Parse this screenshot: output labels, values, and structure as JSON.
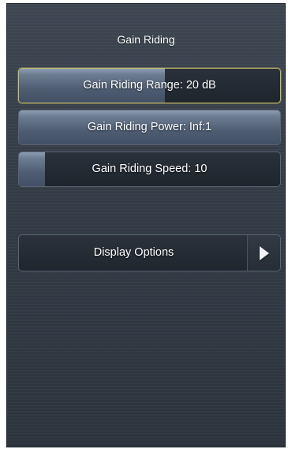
{
  "panel": {
    "title": "Gain Riding"
  },
  "controls": [
    {
      "label": "Gain Riding Range: 20 dB",
      "level_fraction": 0.56,
      "selected": true
    },
    {
      "label": "Gain Riding Power: Inf:1",
      "level_fraction": 1.0,
      "selected": false
    },
    {
      "label": "Gain Riding Speed: 10",
      "level_fraction": 0.1,
      "selected": false
    }
  ],
  "display_options": {
    "label": "Display Options",
    "icon": "chevron-right-icon"
  },
  "colors": {
    "selected_border": "#c9bd62",
    "fill": "#6c7c91",
    "panel_background": "#353d48"
  }
}
